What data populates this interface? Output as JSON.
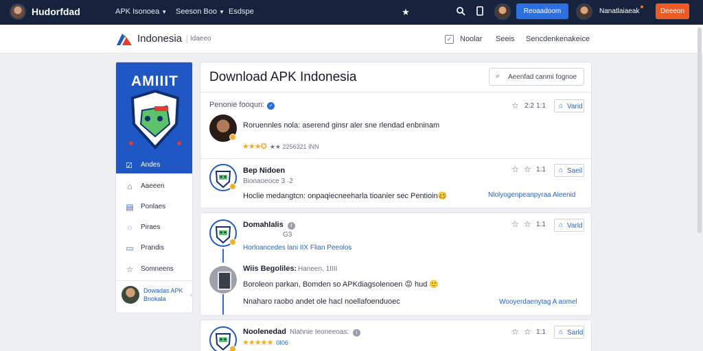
{
  "topbar": {
    "brand": "Hudorfdad",
    "menu": [
      "APK Isonoea",
      "Seeson Boo",
      "Esdspe"
    ],
    "blue_button": "Reoaadoom",
    "user_name": "Nanatlaiaeak",
    "orange_button": "Deeeon"
  },
  "subbar": {
    "title": "Indonesia",
    "tag": "Idaeeo",
    "links": [
      "Noolar",
      "Seeis",
      "Sencdenkenakeice"
    ]
  },
  "sidebar": {
    "hero_title": "AMIIIT",
    "active_label": "Andes",
    "items": [
      "Aaeeen",
      "Ponlaes",
      "Piraes",
      "Prandis",
      "Somneens"
    ],
    "user_name": "Dowadas APK Bnokala"
  },
  "main": {
    "title": "Download APK Indonesia",
    "search_placeholder": "Aeenfad canmi fognoe",
    "section_label": "Penonie fooqun:",
    "post1": {
      "text": "Roruennles nola: aserend ginsr aler sne rlendad enbninam",
      "stars": "★★★✪",
      "meta": "★★ 2256321 INN",
      "count": "2:2",
      "extra": "1:1",
      "action": "Varid"
    },
    "post2": {
      "name": "Bep Nidoen",
      "sub": "Bionaoeoce 3 ·2",
      "text": "Hoclie medangtcn: onpaqiecneeharla tioanier sec Pentioin🥴",
      "count": "1:1",
      "action": "Saeil",
      "link": "Nlolyogenpeanpyraa Aleenid"
    },
    "post3": {
      "name": "Domahlalis",
      "sub": "G3",
      "link": "Horloancedes lani IIX Flian Peeolos",
      "reply_name": "Wiis Begoliles:",
      "reply_time": "Haneen, 1IIII",
      "reply_text": "Boroleon parkan, Bomden so APKdiagsolenoen 😡 hud 🙂",
      "reply_text2": "Nnaharo raobo andet ole hacl noellafoenduoec",
      "count": "1:1",
      "action": "Varld",
      "link2": "Wooyerdaenytag A aomel"
    },
    "post4": {
      "name": "Noolenedad",
      "sub": "Nlahnie Ieoneeoas:",
      "stars": "★★★★★",
      "meta": "0I06",
      "count": "1:1",
      "action": "Sarld"
    }
  }
}
